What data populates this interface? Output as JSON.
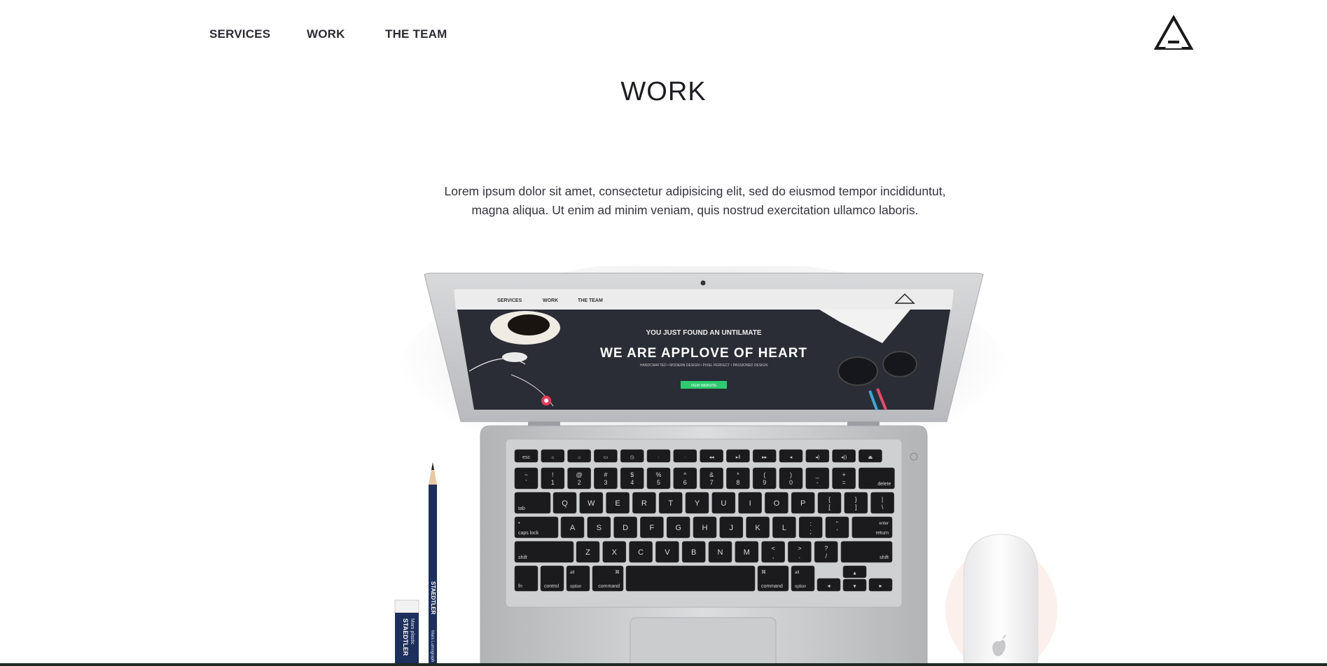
{
  "nav": {
    "items": [
      {
        "label": "SERVICES"
      },
      {
        "label": "WORK"
      },
      {
        "label": "THE TEAM"
      }
    ],
    "logo_icon": "triangle-logo-icon"
  },
  "section": {
    "title": "WORK",
    "lead_line1": "Lorem ipsum dolor sit amet, consectetur adipisicing elit, sed do eiusmod tempor incididuntut,",
    "lead_line2": "magna aliqua. Ut enim ad minim veniam, quis nostrud exercitation ullamco laboris."
  },
  "laptop_screen": {
    "nav": [
      "SERVICES",
      "WORK",
      "THE TEAM"
    ],
    "kicker": "YOU JUST FOUND AN UNTILMATE",
    "headline": "WE ARE APPLOVE OF HEART",
    "tagline": "HANDCRAFTED • MODERN DESIGN • PIXEL PERFECT • PASSIONED DESIGN",
    "button": "VIEW WEBSITE"
  },
  "pencil": {
    "brand": "STAEDTLER",
    "text2": "Mars Lumograph"
  },
  "eraser": {
    "brand": "STAEDTLER",
    "text2": "Mars plastic"
  },
  "keyboard": {
    "fn_row": [
      "esc",
      "☼",
      "☼",
      "▭",
      "◷",
      "·",
      "·",
      "◂◂",
      "▸‖",
      "▸▸",
      "◂",
      "◂)",
      "◂))",
      "⏏"
    ],
    "num_row": [
      [
        "~",
        "`"
      ],
      [
        "!",
        "1"
      ],
      [
        "@",
        "2"
      ],
      [
        "#",
        "3"
      ],
      [
        "$",
        "4"
      ],
      [
        "%",
        "5"
      ],
      [
        "^",
        "6"
      ],
      [
        "&",
        "7"
      ],
      [
        "*",
        "8"
      ],
      [
        "(",
        "9"
      ],
      [
        ")",
        "0"
      ],
      [
        "_",
        "-"
      ],
      [
        "+",
        "="
      ]
    ],
    "delete": "delete",
    "tab": "tab",
    "q_row": [
      "Q",
      "W",
      "E",
      "R",
      "T",
      "Y",
      "U",
      "I",
      "O",
      "P"
    ],
    "q_row_extra": [
      [
        "{",
        "["
      ],
      [
        "}",
        "]"
      ],
      [
        "|",
        "\\"
      ]
    ],
    "caps": "caps lock",
    "a_row": [
      "A",
      "S",
      "D",
      "F",
      "G",
      "H",
      "J",
      "K",
      "L"
    ],
    "a_row_extra": [
      [
        ":",
        ";"
      ],
      [
        "\"",
        "'"
      ]
    ],
    "return_top": "enter",
    "return": "return",
    "shift": "shift",
    "z_row": [
      "Z",
      "X",
      "C",
      "V",
      "B",
      "N",
      "M"
    ],
    "z_row_extra": [
      [
        "<",
        ","
      ],
      [
        ">",
        "."
      ],
      [
        "?",
        "/"
      ]
    ],
    "fn": "fn",
    "control": "control",
    "option": "option",
    "command": "command",
    "cmd_symbol": "⌘",
    "alt_symbol": "alt",
    "arrows": [
      "◂",
      "▴",
      "▾",
      "▸"
    ]
  },
  "colors": {
    "screen_bg": "#2b2d36",
    "accent_green": "#2ecc71",
    "nav_text": "#2a2a33"
  }
}
